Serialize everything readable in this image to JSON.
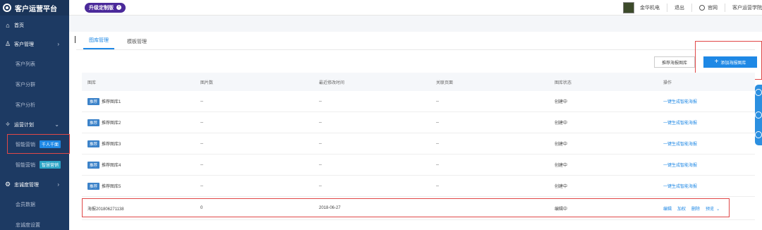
{
  "brand": "客户运营平台",
  "topbar": {
    "upgrade_label": "升级定制版",
    "user_name": "金华机电",
    "logout": "退出",
    "official_site": "官网",
    "academy": "客户运营学院"
  },
  "sidebar": {
    "home": "首页",
    "customer_mgmt": "客户管理",
    "customer_list": "客户列表",
    "customer_groups": "客户分群",
    "customer_analysis": "客户分析",
    "ops_plan": "运营计划",
    "smart_marketing_1": "智能营销",
    "smart_marketing_1_tag": "千人千面",
    "smart_marketing_2": "智能营销",
    "smart_marketing_2_tag": "智慧营销",
    "loyalty_mgmt": "忠诚度管理",
    "member_data": "会员数据",
    "loyalty_settings": "忠诚度设置"
  },
  "tabs": [
    "图库管理",
    "模板管理"
  ],
  "actions": {
    "recommend_button": "推荐海报图库",
    "add_button": "添加海报图库"
  },
  "table": {
    "headers": [
      "图库",
      "图片数",
      "最近修改时间",
      "关联页面",
      "图库状态",
      "操作"
    ],
    "rows": [
      {
        "badge": "推荐",
        "name": "推荐图库1",
        "count": "--",
        "modified": "--",
        "page": "--",
        "status": "创建中",
        "op": "一键生成智能海报"
      },
      {
        "badge": "推荐",
        "name": "推荐图库2",
        "count": "--",
        "modified": "--",
        "page": "--",
        "status": "创建中",
        "op": "一键生成智能海报"
      },
      {
        "badge": "推荐",
        "name": "推荐图库3",
        "count": "--",
        "modified": "--",
        "page": "--",
        "status": "创建中",
        "op": "一键生成智能海报"
      },
      {
        "badge": "推荐",
        "name": "推荐图库4",
        "count": "--",
        "modified": "--",
        "page": "--",
        "status": "创建中",
        "op": "一键生成智能海报"
      },
      {
        "badge": "推荐",
        "name": "推荐图库5",
        "count": "--",
        "modified": "--",
        "page": "--",
        "status": "创建中",
        "op": "一键生成智能海报"
      }
    ],
    "last_row": {
      "name": "海报201806271138",
      "count": "0",
      "modified": "2018-06-27",
      "page": "",
      "status": "编辑中",
      "ops": [
        "编辑",
        "加权",
        "删除",
        "预览"
      ]
    }
  }
}
